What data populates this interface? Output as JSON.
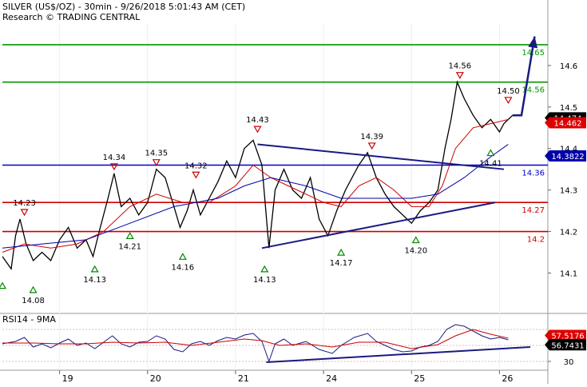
{
  "chart_data": [
    {
      "type": "line",
      "title": "SILVER (US$/OZ) - 30min - 9/26/2018 5:01:43 AM (CET)",
      "subtitle": "Research © TRADING CENTRAL",
      "y_ticks": [
        "14.6",
        "14.5",
        "14.4",
        "14.3",
        "14.2",
        "14.1"
      ],
      "ylim": [
        14.02,
        14.7
      ],
      "x_ticks": [
        "19",
        "20",
        "21",
        "24",
        "25",
        "26"
      ],
      "x_tick_day_index": [
        1,
        2,
        3,
        4,
        5,
        6
      ],
      "x_range_days": [
        0.35,
        6.55
      ],
      "series": [
        {
          "name": "",
          "color": "#000000",
          "points": [
            [
              0.35,
              14.14
            ],
            [
              0.45,
              14.11
            ],
            [
              0.5,
              14.19
            ],
            [
              0.55,
              14.23
            ],
            [
              0.62,
              14.17
            ],
            [
              0.7,
              14.13
            ],
            [
              0.8,
              14.15
            ],
            [
              0.9,
              14.13
            ],
            [
              1.0,
              14.18
            ],
            [
              1.1,
              14.21
            ],
            [
              1.2,
              14.16
            ],
            [
              1.3,
              14.18
            ],
            [
              1.38,
              14.14
            ],
            [
              1.45,
              14.2
            ],
            [
              1.55,
              14.28
            ],
            [
              1.62,
              14.34
            ],
            [
              1.7,
              14.26
            ],
            [
              1.8,
              14.28
            ],
            [
              1.9,
              14.24
            ],
            [
              2.0,
              14.27
            ],
            [
              2.05,
              14.31
            ],
            [
              2.1,
              14.35
            ],
            [
              2.2,
              14.33
            ],
            [
              2.3,
              14.26
            ],
            [
              2.37,
              14.21
            ],
            [
              2.45,
              14.25
            ],
            [
              2.52,
              14.3
            ],
            [
              2.6,
              14.24
            ],
            [
              2.7,
              14.28
            ],
            [
              2.8,
              14.32
            ],
            [
              2.9,
              14.37
            ],
            [
              3.0,
              14.33
            ],
            [
              3.1,
              14.4
            ],
            [
              3.2,
              14.42
            ],
            [
              3.3,
              14.36
            ],
            [
              3.38,
              14.16
            ],
            [
              3.45,
              14.3
            ],
            [
              3.55,
              14.35
            ],
            [
              3.65,
              14.3
            ],
            [
              3.75,
              14.28
            ],
            [
              3.85,
              14.33
            ],
            [
              3.95,
              14.23
            ],
            [
              4.05,
              14.19
            ],
            [
              4.15,
              14.25
            ],
            [
              4.25,
              14.3
            ],
            [
              4.4,
              14.36
            ],
            [
              4.5,
              14.39
            ],
            [
              4.6,
              14.33
            ],
            [
              4.7,
              14.29
            ],
            [
              4.8,
              14.26
            ],
            [
              4.9,
              14.24
            ],
            [
              5.0,
              14.22
            ],
            [
              5.1,
              14.25
            ],
            [
              5.2,
              14.27
            ],
            [
              5.3,
              14.3
            ],
            [
              5.38,
              14.4
            ],
            [
              5.45,
              14.47
            ],
            [
              5.52,
              14.56
            ],
            [
              5.6,
              14.52
            ],
            [
              5.7,
              14.48
            ],
            [
              5.8,
              14.45
            ],
            [
              5.9,
              14.47
            ],
            [
              6.0,
              14.44
            ],
            [
              6.05,
              14.46
            ],
            [
              6.1,
              14.47
            ],
            [
              6.15,
              14.48
            ]
          ]
        },
        {
          "name": "",
          "color": "#cc0000",
          "points": [
            [
              0.35,
              14.15
            ],
            [
              0.6,
              14.17
            ],
            [
              0.9,
              14.16
            ],
            [
              1.2,
              14.17
            ],
            [
              1.5,
              14.2
            ],
            [
              1.8,
              14.26
            ],
            [
              2.1,
              14.29
            ],
            [
              2.4,
              14.27
            ],
            [
              2.7,
              14.27
            ],
            [
              3.0,
              14.31
            ],
            [
              3.2,
              14.36
            ],
            [
              3.4,
              14.33
            ],
            [
              3.6,
              14.31
            ],
            [
              3.8,
              14.29
            ],
            [
              4.0,
              14.27
            ],
            [
              4.2,
              14.26
            ],
            [
              4.4,
              14.31
            ],
            [
              4.6,
              14.33
            ],
            [
              4.8,
              14.3
            ],
            [
              5.0,
              14.26
            ],
            [
              5.2,
              14.26
            ],
            [
              5.35,
              14.31
            ],
            [
              5.5,
              14.4
            ],
            [
              5.7,
              14.45
            ],
            [
              5.9,
              14.46
            ],
            [
              6.1,
              14.47
            ]
          ]
        },
        {
          "name": "",
          "color": "#0000aa",
          "points": [
            [
              0.35,
              14.16
            ],
            [
              0.8,
              14.17
            ],
            [
              1.3,
              14.18
            ],
            [
              1.8,
              14.22
            ],
            [
              2.3,
              14.26
            ],
            [
              2.8,
              14.28
            ],
            [
              3.1,
              14.31
            ],
            [
              3.4,
              14.33
            ],
            [
              3.8,
              14.31
            ],
            [
              4.2,
              14.28
            ],
            [
              4.6,
              14.28
            ],
            [
              5.0,
              14.28
            ],
            [
              5.3,
              14.29
            ],
            [
              5.6,
              14.33
            ],
            [
              5.9,
              14.38
            ],
            [
              6.1,
              14.41
            ]
          ]
        }
      ],
      "horizontal_levels": [
        {
          "value": 14.65,
          "label": "14.65",
          "color": "#009900"
        },
        {
          "value": 14.56,
          "label": "14.56",
          "color": "#009900"
        },
        {
          "value": 14.36,
          "label": "14.36",
          "color": "#0000cc"
        },
        {
          "value": 14.27,
          "label": "14.27",
          "color": "#cc0000"
        },
        {
          "value": 14.2,
          "label": "14.2",
          "color": "#cc0000"
        }
      ],
      "trendlines": [
        {
          "from": [
            3.25,
            14.41
          ],
          "to": [
            6.05,
            14.35
          ],
          "color": "#1a1a80"
        },
        {
          "from": [
            3.3,
            14.16
          ],
          "to": [
            5.95,
            14.27
          ],
          "color": "#1a1a80"
        }
      ],
      "projection_arrow": {
        "points": [
          [
            6.15,
            14.48
          ],
          [
            6.25,
            14.48
          ],
          [
            6.4,
            14.67
          ]
        ],
        "color": "#1a1a80"
      },
      "peak_annotations": [
        {
          "x": 0.6,
          "y": 14.23,
          "label": "14.23"
        },
        {
          "x": 1.62,
          "y": 14.34,
          "label": "14.34"
        },
        {
          "x": 2.1,
          "y": 14.35,
          "label": "14.35"
        },
        {
          "x": 2.55,
          "y": 14.32,
          "label": "14.32"
        },
        {
          "x": 3.25,
          "y": 14.43,
          "label": "14.43"
        },
        {
          "x": 4.55,
          "y": 14.39,
          "label": "14.39"
        },
        {
          "x": 5.55,
          "y": 14.56,
          "label": "14.56"
        },
        {
          "x": 6.1,
          "y": 14.5,
          "label": "14.50"
        }
      ],
      "trough_annotations": [
        {
          "x": 0.35,
          "y": 14.09,
          "label": ""
        },
        {
          "x": 0.7,
          "y": 14.08,
          "label": "14.08"
        },
        {
          "x": 1.4,
          "y": 14.13,
          "label": "14.13"
        },
        {
          "x": 1.8,
          "y": 14.21,
          "label": "14.21"
        },
        {
          "x": 2.4,
          "y": 14.16,
          "label": "14.16"
        },
        {
          "x": 3.33,
          "y": 14.13,
          "label": "14.13"
        },
        {
          "x": 4.2,
          "y": 14.17,
          "label": "14.17"
        },
        {
          "x": 5.05,
          "y": 14.2,
          "label": "14.20"
        },
        {
          "x": 5.9,
          "y": 14.41,
          "label": "14.41"
        }
      ],
      "price_tags": [
        {
          "value": 14.474,
          "label": "14.474",
          "fill": "#000000",
          "text_color": "#ffffff"
        },
        {
          "value": 14.462,
          "label": "14.462",
          "fill": "#dd0000",
          "text_color": "#ffffff"
        },
        {
          "value": 14.3822,
          "label": "14.3822",
          "fill": "#0000aa",
          "text_color": "#ffffff"
        }
      ]
    },
    {
      "type": "line",
      "title": "RSI14 - 9MA",
      "y_ticks": [
        "50",
        "30"
      ],
      "ylim": [
        22,
        86
      ],
      "series": [
        {
          "name": "",
          "color": "#1a1a80",
          "points": [
            [
              0.35,
              52
            ],
            [
              0.5,
              55
            ],
            [
              0.6,
              60
            ],
            [
              0.7,
              48
            ],
            [
              0.8,
              52
            ],
            [
              0.9,
              47
            ],
            [
              1.0,
              53
            ],
            [
              1.1,
              58
            ],
            [
              1.2,
              50
            ],
            [
              1.3,
              53
            ],
            [
              1.4,
              46
            ],
            [
              1.5,
              54
            ],
            [
              1.6,
              62
            ],
            [
              1.7,
              52
            ],
            [
              1.8,
              48
            ],
            [
              1.9,
              54
            ],
            [
              2.0,
              55
            ],
            [
              2.1,
              62
            ],
            [
              2.2,
              58
            ],
            [
              2.3,
              45
            ],
            [
              2.4,
              42
            ],
            [
              2.5,
              52
            ],
            [
              2.6,
              55
            ],
            [
              2.7,
              50
            ],
            [
              2.8,
              56
            ],
            [
              2.9,
              60
            ],
            [
              3.0,
              58
            ],
            [
              3.1,
              63
            ],
            [
              3.2,
              65
            ],
            [
              3.3,
              55
            ],
            [
              3.38,
              30
            ],
            [
              3.45,
              52
            ],
            [
              3.55,
              58
            ],
            [
              3.65,
              50
            ],
            [
              3.8,
              55
            ],
            [
              3.95,
              45
            ],
            [
              4.1,
              40
            ],
            [
              4.2,
              50
            ],
            [
              4.35,
              60
            ],
            [
              4.5,
              65
            ],
            [
              4.6,
              55
            ],
            [
              4.7,
              50
            ],
            [
              4.8,
              45
            ],
            [
              4.9,
              42
            ],
            [
              5.0,
              43
            ],
            [
              5.1,
              48
            ],
            [
              5.2,
              50
            ],
            [
              5.3,
              55
            ],
            [
              5.4,
              70
            ],
            [
              5.5,
              76
            ],
            [
              5.6,
              74
            ],
            [
              5.7,
              68
            ],
            [
              5.8,
              62
            ],
            [
              5.9,
              58
            ],
            [
              6.0,
              60
            ],
            [
              6.1,
              57
            ]
          ]
        },
        {
          "name": "",
          "color": "#cc0000",
          "points": [
            [
              0.35,
              53
            ],
            [
              0.7,
              53
            ],
            [
              1.0,
              52
            ],
            [
              1.3,
              52
            ],
            [
              1.6,
              54
            ],
            [
              1.9,
              53
            ],
            [
              2.2,
              54
            ],
            [
              2.5,
              50
            ],
            [
              2.8,
              54
            ],
            [
              3.1,
              58
            ],
            [
              3.3,
              56
            ],
            [
              3.5,
              50
            ],
            [
              3.8,
              52
            ],
            [
              4.1,
              48
            ],
            [
              4.4,
              54
            ],
            [
              4.7,
              54
            ],
            [
              5.0,
              46
            ],
            [
              5.3,
              51
            ],
            [
              5.5,
              62
            ],
            [
              5.7,
              70
            ],
            [
              5.9,
              64
            ],
            [
              6.1,
              59
            ]
          ]
        }
      ],
      "trendline": {
        "from": [
          3.35,
          29
        ],
        "to": [
          6.35,
          48
        ],
        "color": "#1a1a80"
      },
      "value_tags": [
        {
          "value": 57.5176,
          "label": "57.5176",
          "fill": "#dd0000",
          "text_color": "#ffffff"
        },
        {
          "value": 56.7431,
          "label": "56.7431",
          "fill": "#000000",
          "text_color": "#ffffff"
        }
      ],
      "levels": [
        70,
        50,
        30
      ]
    }
  ]
}
